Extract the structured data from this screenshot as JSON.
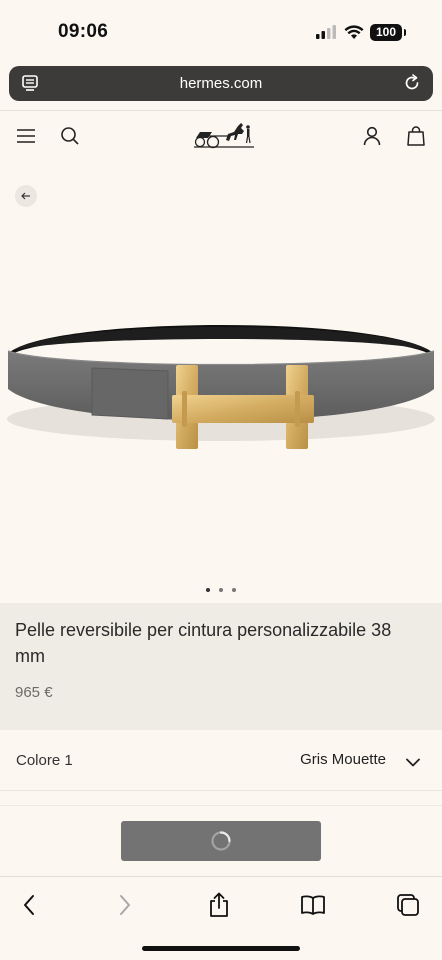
{
  "status_bar": {
    "time": "09:06",
    "battery": "100",
    "icons": [
      "signal-icon",
      "wifi-icon",
      "battery-icon"
    ]
  },
  "browser": {
    "url": "hermes.com",
    "icons": [
      "reader-icon",
      "reload-icon"
    ]
  },
  "header": {
    "icons": [
      "menu-icon",
      "search-icon",
      "hermes-logo",
      "account-icon",
      "bag-icon"
    ]
  },
  "product": {
    "title": "Pelle reversibile per cintura personalizzabile 38 mm",
    "price": "965 €",
    "image_page_total": 3,
    "image_page_current": 1
  },
  "options": {
    "color_label": "Colore 1",
    "color_value": "Gris Mouette"
  },
  "toolbar": {
    "icons": [
      "back-icon",
      "forward-icon",
      "share-icon",
      "bookmarks-icon",
      "tabs-icon"
    ]
  },
  "colors": {
    "background": "#fcf7f1",
    "card": "#efebe5",
    "button": "#737373",
    "belt_grey": "#6e6e6e",
    "buckle_gold": "#d8b36a"
  }
}
